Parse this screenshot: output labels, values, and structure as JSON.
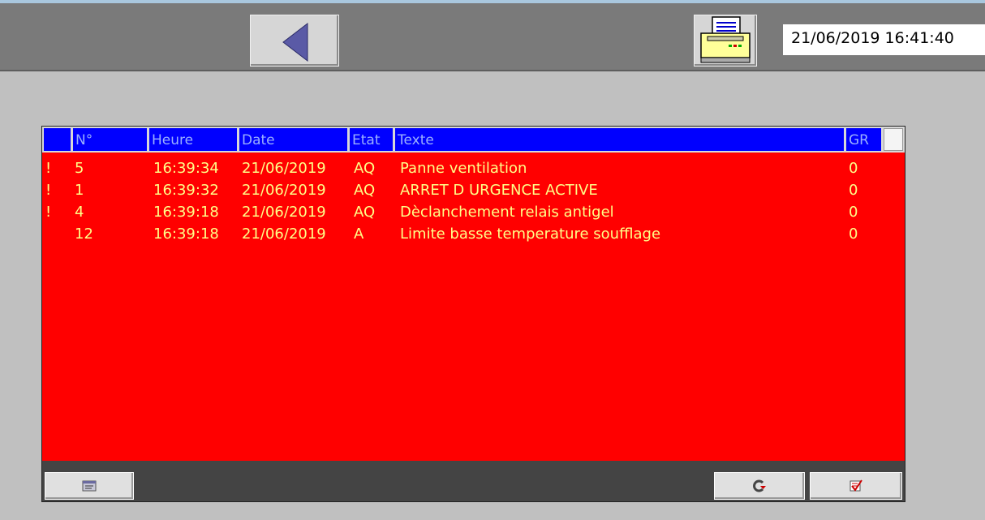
{
  "header": {
    "datetime": "21/06/2019 16:41:40",
    "back_icon": "back-arrow-icon",
    "print_icon": "printer-icon"
  },
  "alarm_table": {
    "columns": [
      "",
      "N°",
      "Heure",
      "Date",
      "Etat",
      "Texte",
      "GR"
    ],
    "rows": [
      {
        "flag": "!",
        "no": "5",
        "heure": "16:39:34",
        "date": "21/06/2019",
        "etat": "AQ",
        "texte": "Panne ventilation",
        "gr": "0"
      },
      {
        "flag": "!",
        "no": "1",
        "heure": "16:39:32",
        "date": "21/06/2019",
        "etat": "AQ",
        "texte": "ARRET D URGENCE ACTIVE",
        "gr": "0"
      },
      {
        "flag": "!",
        "no": "4",
        "heure": "16:39:18",
        "date": "21/06/2019",
        "etat": "AQ",
        "texte": "Dèclanchement relais antigel",
        "gr": "0"
      },
      {
        "flag": "",
        "no": "12",
        "heure": "16:39:18",
        "date": "21/06/2019",
        "etat": "A",
        "texte": "Limite basse temperature soufflage",
        "gr": "0"
      }
    ]
  },
  "toolbar": {
    "left_icon": "alarm-view-icon",
    "middle_icon": "loop-icon",
    "right_icon": "acknowledge-icon"
  },
  "colors": {
    "list_background": "#ff0000",
    "header_background": "#0000ff",
    "row_text": "#ffff88",
    "header_text": "#9ab0ff"
  }
}
